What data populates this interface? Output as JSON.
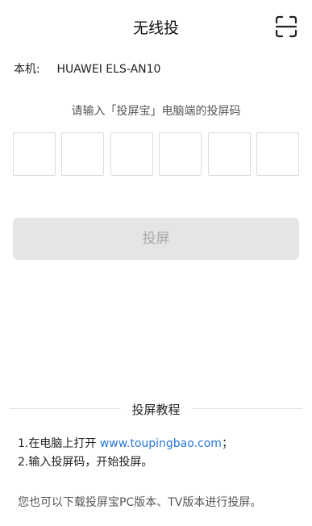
{
  "header": {
    "title": "无线投",
    "scan_icon": "scan-frame-icon"
  },
  "device": {
    "label": "本机:",
    "name": "HUAWEI ELS-AN10"
  },
  "instruction": "请输入「投屏宝」电脑端的投屏码",
  "code_boxes": [
    "",
    "",
    "",
    "",
    "",
    ""
  ],
  "cast_button": {
    "label": "投屏",
    "background": "#e5e5e5",
    "text_color": "#a8a8a8"
  },
  "tutorial": {
    "title": "投屏教程",
    "step1_prefix": "1.在电脑上打开 ",
    "step1_link": "www.toupingbao.com",
    "step1_suffix": "；",
    "step2": "2.输入投屏码，开始投屏。",
    "link_color": "#2a78d6"
  },
  "note": "您也可以下载投屏宝PC版本、TV版本进行投屏。"
}
